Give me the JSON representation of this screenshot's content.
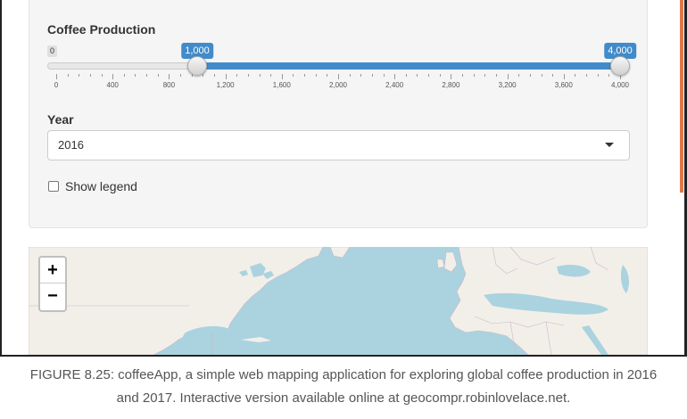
{
  "panel": {
    "slider": {
      "label": "Coffee Production",
      "min_label": "0",
      "min": 0,
      "max": 4000,
      "low": 1000,
      "high": 4000,
      "low_label": "1,000",
      "high_label": "4,000",
      "tick_labels": [
        "0",
        "400",
        "800",
        "1,200",
        "1,600",
        "2,000",
        "2,400",
        "2,800",
        "3,200",
        "3,600",
        "4,000"
      ],
      "accent_color": "#428bca"
    },
    "year": {
      "label": "Year",
      "selected": "2016",
      "caret_icon": "caret-down-icon"
    },
    "legend_checkbox": {
      "label": "Show legend",
      "checked": false
    }
  },
  "map": {
    "zoom_in_label": "+",
    "zoom_out_label": "−",
    "water_color": "#aad3df",
    "land_color": "#f2efe9"
  },
  "caption": {
    "line1": "FIGURE 8.25: coffeeApp, a simple web mapping application for exploring global coffee production in 2016",
    "line2": "and 2017. Interactive version available online at geocompr.robinlovelace.net."
  }
}
